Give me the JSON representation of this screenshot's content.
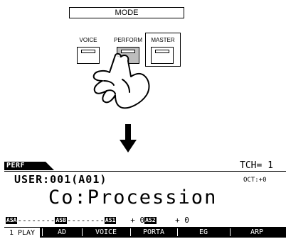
{
  "mode_panel": {
    "title": "MODE",
    "buttons": [
      {
        "label": "VOICE"
      },
      {
        "label": "PERFORM"
      },
      {
        "label": "MASTER"
      }
    ]
  },
  "display": {
    "mode_tag": "PERF",
    "tch": "TCH= 1",
    "user_line": "USER:001(A01)",
    "octave": "OCT:+0",
    "performance_name": "Co:Procession",
    "assign_row": {
      "asa": "ASA",
      "asa_dashes": "--------",
      "asb": "ASB",
      "asb_dashes": "--------",
      "as1": "AS1",
      "as1_value": "+ 0",
      "as2": "AS2",
      "as2_value": "+ 0"
    },
    "tabs": [
      {
        "label": "1 PLAY"
      },
      {
        "label": "AD"
      },
      {
        "label": "VOICE"
      },
      {
        "label": "PORTA"
      },
      {
        "label": "EG"
      },
      {
        "label": "ARP"
      }
    ]
  }
}
